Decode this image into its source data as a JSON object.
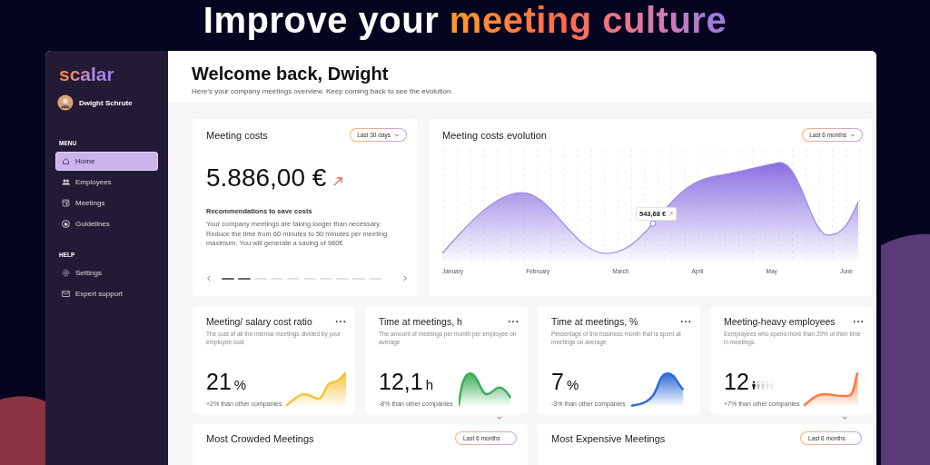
{
  "headline": {
    "plain": "Improve your",
    "highlight": "meeting culture"
  },
  "sidebar": {
    "logo": "scalar",
    "user": "Dwight Schrute",
    "sections": [
      {
        "title": "MENU",
        "items": [
          {
            "label": "Home",
            "selected": true
          },
          {
            "label": "Employees",
            "selected": false
          },
          {
            "label": "Meetings",
            "selected": false
          },
          {
            "label": "Guidelines",
            "selected": false
          }
        ]
      },
      {
        "title": "HELP",
        "items": [
          {
            "label": "Settings",
            "selected": false
          },
          {
            "label": "Expert support",
            "selected": false
          }
        ]
      }
    ]
  },
  "header": {
    "title": "Welcome back, Dwight",
    "subtitle": "Here’s your company meetings overview. Keep coming back to see the evolution."
  },
  "costs_card": {
    "title": "Meeting costs",
    "period": "Last 30 days",
    "amount": "5.886,00 €",
    "rec_title": "Recommendations to save costs",
    "rec_text": "Your company meetings are taking longer than necessary. Reduce the time from 60 minutes to 50 minutes per meeting maximum. You will generate a saving of 980€",
    "pages": [
      {
        "selected": true
      },
      {
        "selected": true
      },
      {
        "selected": false
      },
      {
        "selected": false
      },
      {
        "selected": false
      },
      {
        "selected": false
      },
      {
        "selected": false
      },
      {
        "selected": false
      },
      {
        "selected": false
      },
      {
        "selected": false
      }
    ]
  },
  "evolution_card": {
    "title": "Meeting costs evolution",
    "period": "Last 6 months",
    "tooltip": "543,68 €",
    "months": [
      "January",
      "February",
      "March",
      "April",
      "May",
      "June"
    ]
  },
  "kpis": [
    {
      "title": "Meeting/ salary cost ratio",
      "description": "The cost of all the internal meetings divided by your employee cost",
      "value": "21",
      "unit": "%",
      "comparison": "+2% than other companies",
      "color": "#f5c23a"
    },
    {
      "title": "Time at meetings, h",
      "description": "The amount of meetings per month per employee on average",
      "value": "12,1",
      "unit": "h",
      "comparison": "-8% than other companies",
      "color": "#3fae5a"
    },
    {
      "title": "Time at meetings, %",
      "description": "Percentage of the business month that is spent at meetings on average",
      "value": "7",
      "unit": "%",
      "comparison": "-3% than other companies",
      "color": "#2f6bd8"
    },
    {
      "title": "Meeting-heavy employees",
      "description": "Eemployees who spend more than 20% of their time in meetings.",
      "value": "12",
      "comparison": "+7% than other companies",
      "color": "#ff7a3d",
      "people": [
        {
          "highlighted": true
        },
        {
          "highlighted": false
        },
        {
          "highlighted": false
        },
        {
          "highlighted": false
        },
        {
          "highlighted": false
        }
      ]
    }
  ],
  "bottom_cards": [
    {
      "title": "Most Crowded Meetings",
      "period": "Last 6 months"
    },
    {
      "title": "Most Expensive Meetings",
      "period": "Last 6 months"
    }
  ]
}
